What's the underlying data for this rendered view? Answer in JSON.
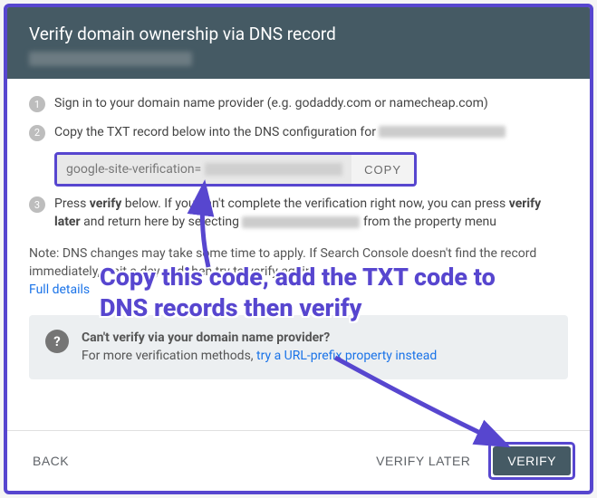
{
  "header": {
    "title": "Verify domain ownership via DNS record"
  },
  "steps": {
    "s1": "Sign in to your domain name provider (e.g. godaddy.com or namecheap.com)",
    "s2_prefix": "Copy the TXT record below into the DNS configuration for ",
    "txt_prefix": "google-site-verification=",
    "copy_label": "COPY",
    "s3_a": "Press ",
    "s3_verify": "verify",
    "s3_b": " below. If you can't complete the verification right now, you can press ",
    "s3_verify_later": "verify later",
    "s3_c": " and return here by selecting ",
    "s3_d": " from the property menu"
  },
  "note": {
    "prefix": "Note: DNS changes may take some time to apply. If Search Console doesn't find the record immediately, wait a day and then try to verify again",
    "link": "Full details"
  },
  "alt": {
    "title": "Can't verify via your domain name provider?",
    "body": "For more verification methods, ",
    "link": "try a URL-prefix property instead"
  },
  "footer": {
    "back": "BACK",
    "verify_later": "VERIFY LATER",
    "verify": "VERIFY"
  },
  "annotation": "Copy this code, add the TXT code to DNS records then verify"
}
